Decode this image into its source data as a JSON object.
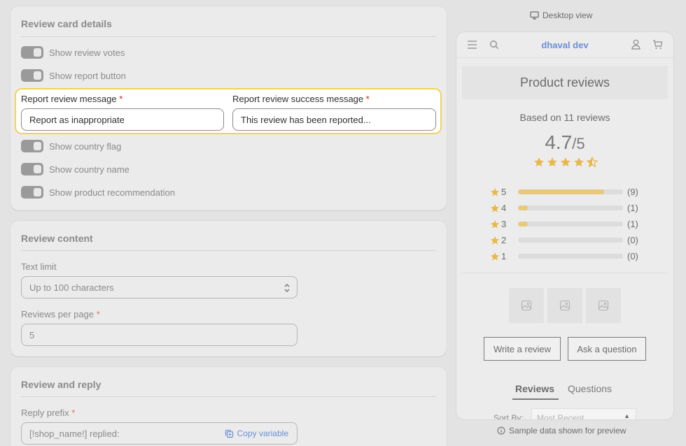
{
  "review_card": {
    "title": "Review card details",
    "toggles_top": [
      {
        "label": "Show review votes"
      },
      {
        "label": "Show report button"
      }
    ],
    "report_message": {
      "label": "Report review message",
      "required": "*",
      "value": "Report as inappropriate"
    },
    "report_success": {
      "label": "Report review success message",
      "required": "*",
      "value": "This review has been reported..."
    },
    "toggles_bottom": [
      {
        "label": "Show country flag"
      },
      {
        "label": "Show country name"
      },
      {
        "label": "Show product recommendation"
      }
    ]
  },
  "review_content": {
    "title": "Review content",
    "text_limit": {
      "label": "Text limit",
      "value": "Up to 100 characters"
    },
    "per_page": {
      "label": "Reviews per page",
      "required": "*",
      "value": "5"
    }
  },
  "review_reply": {
    "title": "Review and reply",
    "reply_prefix": {
      "label": "Reply prefix",
      "required": "*",
      "value": "[!shop_name!] replied:",
      "copy_label": "Copy variable"
    }
  },
  "preview": {
    "view_label": "Desktop view",
    "store_name": "dhaval dev",
    "product_title": "Product reviews",
    "based_on": "Based on 11 reviews",
    "average": "4.7",
    "out_of": "/5",
    "average_value": 4.7,
    "distribution": [
      {
        "stars": "5",
        "count": "(9)",
        "fraction": 0.82
      },
      {
        "stars": "4",
        "count": "(1)",
        "fraction": 0.09
      },
      {
        "stars": "3",
        "count": "(1)",
        "fraction": 0.09
      },
      {
        "stars": "2",
        "count": "(0)",
        "fraction": 0
      },
      {
        "stars": "1",
        "count": "(0)",
        "fraction": 0
      }
    ],
    "write_review": "Write a review",
    "ask_question": "Ask a question",
    "tabs": [
      {
        "label": "Reviews"
      },
      {
        "label": "Questions"
      }
    ],
    "sort_label": "Sort By:",
    "sort_value": "Most Recent",
    "sample_note": "Sample data shown for preview"
  },
  "colors": {
    "highlight": "#f0d45a",
    "star": "#e8b84a",
    "bar": "#e8c87a",
    "link": "#6b8fd8",
    "required": "#c5280c"
  }
}
